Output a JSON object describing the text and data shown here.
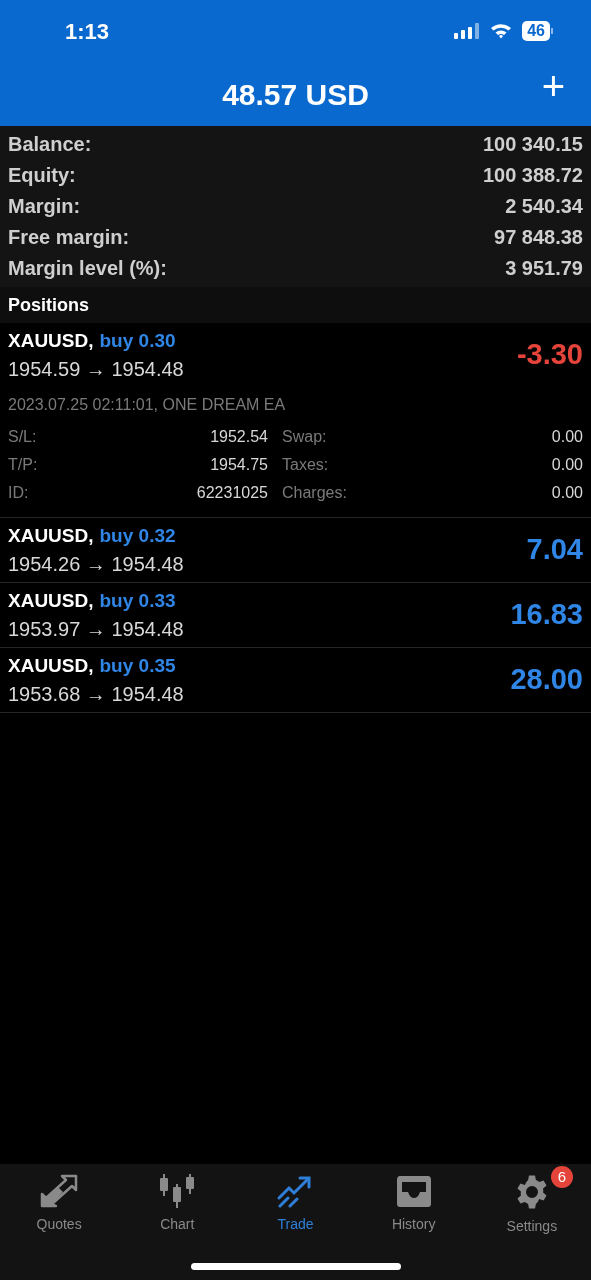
{
  "status_bar": {
    "time": "1:13",
    "battery": "46"
  },
  "header": {
    "title": "48.57 USD",
    "add": "+"
  },
  "summary": [
    {
      "label": "Balance:",
      "value": "100 340.15"
    },
    {
      "label": "Equity:",
      "value": "100 388.72"
    },
    {
      "label": "Margin:",
      "value": "2 540.34"
    },
    {
      "label": "Free margin:",
      "value": "97 848.38"
    },
    {
      "label": "Margin level (%):",
      "value": "3 951.79"
    }
  ],
  "positions_heading": "Positions",
  "positions": [
    {
      "symbol": "XAUUSD,",
      "side": "buy 0.30",
      "prices": "1954.59 → 1954.48",
      "profit": "-3.30",
      "color": "#e5443b",
      "details": {
        "opened": "2023.07.25 02:11:01, ONE DREAM EA",
        "fields": [
          {
            "label": "S/L:",
            "value": "1952.54"
          },
          {
            "label": "Swap:",
            "value": "0.00"
          },
          {
            "label": "T/P:",
            "value": "1954.75"
          },
          {
            "label": "Taxes:",
            "value": "0.00"
          },
          {
            "label": "ID:",
            "value": "62231025"
          },
          {
            "label": "Charges:",
            "value": "0.00"
          }
        ]
      }
    },
    {
      "symbol": "XAUUSD,",
      "side": "buy 0.32",
      "prices": "1954.26 → 1954.48",
      "profit": "7.04",
      "color": "#2f86e6"
    },
    {
      "symbol": "XAUUSD,",
      "side": "buy 0.33",
      "prices": "1953.97 → 1954.48",
      "profit": "16.83",
      "color": "#2f86e6"
    },
    {
      "symbol": "XAUUSD,",
      "side": "buy 0.35",
      "prices": "1953.68 → 1954.48",
      "profit": "28.00",
      "color": "#2f86e6"
    }
  ],
  "tabs": [
    {
      "kind": "quotes",
      "label": "Quotes",
      "selected": false
    },
    {
      "kind": "chart",
      "label": "Chart",
      "selected": false
    },
    {
      "kind": "trade",
      "label": "Trade",
      "selected": true
    },
    {
      "kind": "history",
      "label": "History",
      "selected": false
    },
    {
      "kind": "settings",
      "label": "Settings",
      "selected": false,
      "badge": "6"
    }
  ]
}
